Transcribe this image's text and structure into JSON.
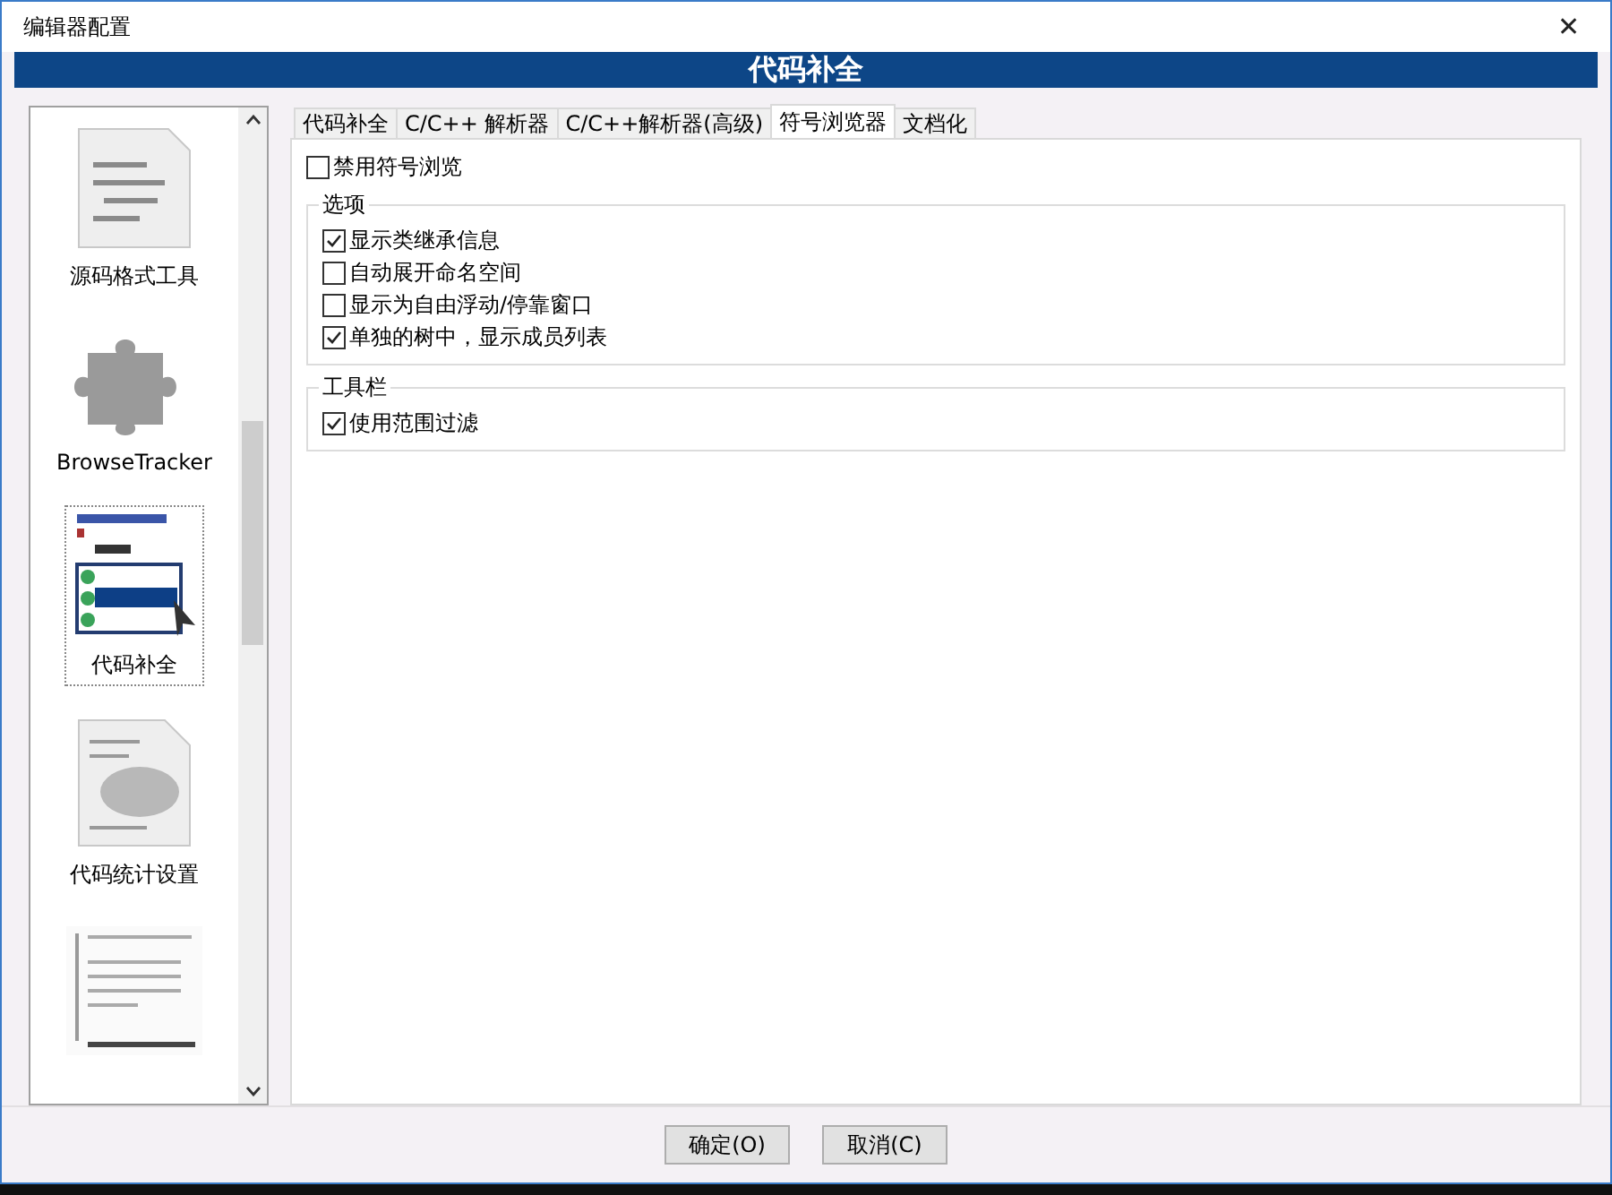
{
  "window": {
    "title": "编辑器配置",
    "close": "✕"
  },
  "header": {
    "title": "代码补全"
  },
  "sidebar": {
    "items": [
      {
        "label": "源码格式工具",
        "kind": "doc",
        "selected": false
      },
      {
        "label": "BrowseTracker",
        "kind": "puzzle",
        "selected": false
      },
      {
        "label": "代码补全",
        "kind": "code",
        "selected": true
      },
      {
        "label": "代码统计设置",
        "kind": "chart",
        "selected": false
      },
      {
        "kind": "doxy",
        "selected": false
      }
    ]
  },
  "tabs": [
    {
      "label": "代码补全",
      "selected": false
    },
    {
      "label": "C/C++ 解析器",
      "selected": false
    },
    {
      "label": "C/C++解析器(高级)",
      "selected": false
    },
    {
      "label": "符号浏览器",
      "selected": true
    },
    {
      "label": "文档化",
      "selected": false
    }
  ],
  "disable_option": {
    "label": "禁用符号浏览",
    "checked": false
  },
  "groups": [
    {
      "title": "选项",
      "options": [
        {
          "label": "显示类继承信息",
          "checked": true
        },
        {
          "label": "自动展开命名空间",
          "checked": false
        },
        {
          "label": "显示为自由浮动/停靠窗口",
          "checked": false
        },
        {
          "label": "单独的树中，显示成员列表",
          "checked": true
        }
      ]
    },
    {
      "title": "工具栏",
      "options": [
        {
          "label": "使用范围过滤",
          "checked": true
        }
      ]
    }
  ],
  "buttons": [
    "确定(O)",
    "取消(C)"
  ]
}
